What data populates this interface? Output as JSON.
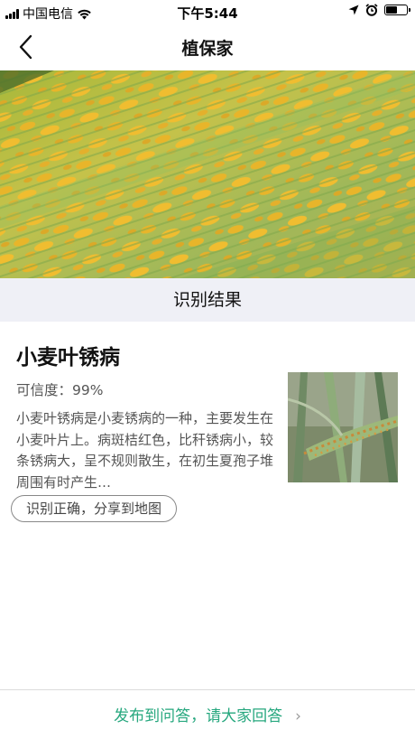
{
  "status_bar": {
    "carrier": "中国电信",
    "time": "下午5:44",
    "battery_level": 0.55
  },
  "nav": {
    "title": "植保家",
    "back_icon": "chevron-left-icon"
  },
  "result_header": {
    "title": "识别结果"
  },
  "result": {
    "disease_name": "小麦叶锈病",
    "confidence": "可信度：99%",
    "description": "小麦叶锈病是小麦锈病的一种，主要发生在小麦叶片上。病斑桔红色，比秆锈病小，较条锈病大，呈不规则散生，在初生夏孢子堆周围有时产生…",
    "share_button": "识别正确，分享到地图"
  },
  "footer": {
    "publish_link": "发布到问答，请大家回答"
  },
  "colors": {
    "accent": "#26a77e",
    "header_bg": "#eff0f6"
  }
}
